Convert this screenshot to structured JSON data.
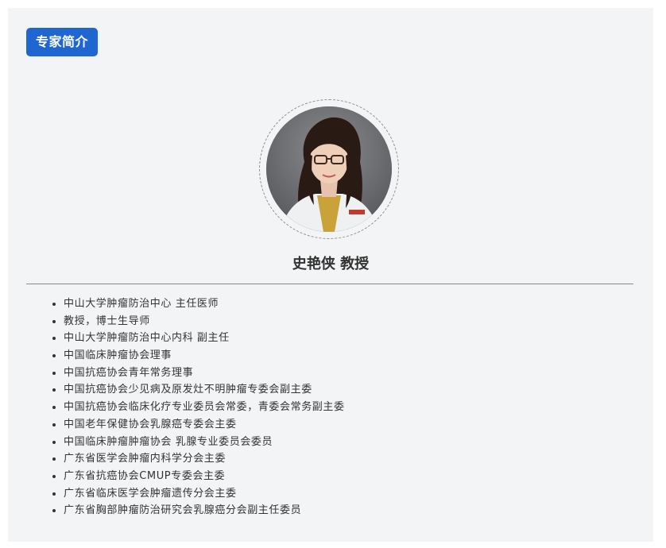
{
  "section_title": "专家简介",
  "expert_name": "史艳侠 教授",
  "avatar_icon": "doctor-portrait",
  "accent_color": "#1f66d1",
  "titles": [
    "中山大学肿瘤防治中心 主任医师",
    "教授，博士生导师",
    "中山大学肿瘤防治中心内科 副主任",
    "中国临床肿瘤协会理事",
    "中国抗癌协会青年常务理事",
    "中国抗癌协会少见病及原发灶不明肿瘤专委会副主委",
    "中国抗癌协会临床化疗专业委员会常委，青委会常务副主委",
    "中国老年保健协会乳腺癌专委会主委",
    "中国临床肿瘤肿瘤协会 乳腺专业委员会委员",
    "广东省医学会肿瘤内科学分会主委",
    "广东省抗癌协会CMUP专委会主委",
    "广东省临床医学会肿瘤遗传分会主委",
    "广东省胸部肿瘤防治研究会乳腺癌分会副主任委员"
  ]
}
